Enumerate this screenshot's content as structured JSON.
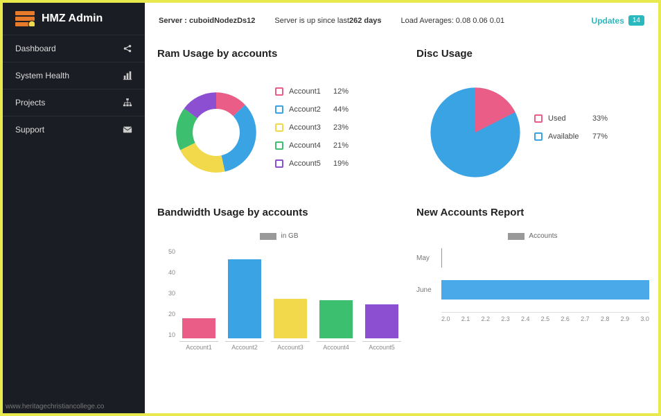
{
  "app": {
    "name": "HMZ Admin"
  },
  "sidebar": {
    "items": [
      {
        "label": "Dashboard",
        "icon": "share-icon"
      },
      {
        "label": "System Health",
        "icon": "bar-chart-icon"
      },
      {
        "label": "Projects",
        "icon": "sitemap-icon"
      },
      {
        "label": "Support",
        "icon": "envelope-icon"
      }
    ]
  },
  "topbar": {
    "server_label": "Server :",
    "server_value": "cuboidNodezDs12",
    "uptime_prefix": "Server is up since last",
    "uptime_value": "262 days",
    "load_label": "Load Averages: 0.08 0.06 0.01",
    "updates_label": "Updates",
    "updates_count": "14"
  },
  "panels": {
    "ram": {
      "title": "Ram Usage by accounts",
      "legend": [
        {
          "label": "Account1",
          "value": "12%",
          "color": "#ea5d87"
        },
        {
          "label": "Account2",
          "value": "44%",
          "color": "#3aa3e3"
        },
        {
          "label": "Account3",
          "value": "23%",
          "color": "#f2d94b"
        },
        {
          "label": "Account4",
          "value": "21%",
          "color": "#3cbf6f"
        },
        {
          "label": "Account5",
          "value": "19%",
          "color": "#8d4fd1"
        }
      ]
    },
    "disc": {
      "title": "Disc Usage",
      "legend": [
        {
          "label": "Used",
          "value": "33%",
          "color": "#ea5d87"
        },
        {
          "label": "Available",
          "value": "77%",
          "color": "#3aa3e3"
        }
      ]
    },
    "bandwidth": {
      "title": "Bandwidth Usage by accounts",
      "legend_label": "in GB",
      "y_ticks": [
        "50",
        "40",
        "30",
        "20",
        "10"
      ]
    },
    "newaccounts": {
      "title": "New Accounts Report",
      "legend_label": "Accounts",
      "rows": [
        {
          "label": "May"
        },
        {
          "label": "June"
        }
      ],
      "x_ticks": [
        "2.0",
        "2.1",
        "2.2",
        "2.3",
        "2.4",
        "2.5",
        "2.6",
        "2.7",
        "2.8",
        "2.9",
        "3.0"
      ]
    }
  },
  "chart_data": [
    {
      "type": "pie",
      "title": "Ram Usage by accounts",
      "series": [
        {
          "name": "Account1",
          "value": 12,
          "color": "#ea5d87"
        },
        {
          "name": "Account2",
          "value": 44,
          "color": "#3aa3e3"
        },
        {
          "name": "Account3",
          "value": 23,
          "color": "#f2d94b"
        },
        {
          "name": "Account4",
          "value": 21,
          "color": "#3cbf6f"
        },
        {
          "name": "Account5",
          "value": 19,
          "color": "#8d4fd1"
        }
      ],
      "donut": true
    },
    {
      "type": "pie",
      "title": "Disc Usage",
      "series": [
        {
          "name": "Used",
          "value": 33,
          "color": "#ea5d87"
        },
        {
          "name": "Available",
          "value": 77,
          "color": "#3aa3e3"
        }
      ],
      "donut": false
    },
    {
      "type": "bar",
      "title": "Bandwidth Usage by accounts",
      "ylabel": "in GB",
      "ylim": [
        0,
        50
      ],
      "categories": [
        "Account1",
        "Account2",
        "Account3",
        "Account4",
        "Account5"
      ],
      "values": [
        11,
        44,
        22,
        21,
        19
      ],
      "colors": [
        "#ea5d87",
        "#3aa3e3",
        "#f2d94b",
        "#3cbf6f",
        "#8d4fd1"
      ]
    },
    {
      "type": "bar",
      "title": "New Accounts Report",
      "orientation": "horizontal",
      "ylabel": "Accounts",
      "xlim": [
        2.0,
        3.0
      ],
      "categories": [
        "May",
        "June"
      ],
      "values": [
        2.0,
        3.0
      ],
      "color": "#4aa9e9"
    }
  ],
  "watermark": "www.heritagechristiancollege.co"
}
